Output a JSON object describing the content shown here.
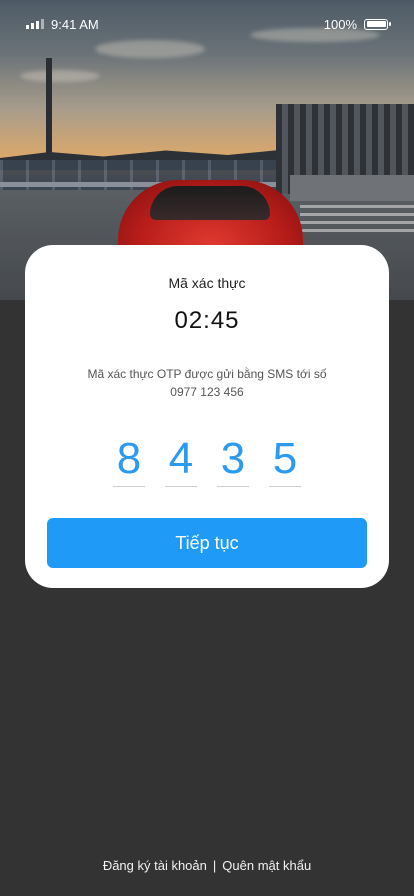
{
  "status_bar": {
    "time": "9:41 AM",
    "battery_percent": "100%",
    "signal_icon": "signal-bars-icon",
    "battery_icon": "battery-full-icon"
  },
  "otp_card": {
    "title": "Mã xác thực",
    "timer": "02:45",
    "description_line1": "Mã xác thực OTP được gửi bằng SMS tới số",
    "phone_number": "0977 123 456",
    "digits": [
      "8",
      "4",
      "3",
      "5"
    ],
    "continue_label": "Tiếp tục"
  },
  "footer": {
    "register_label": "Đăng ký tài khoản",
    "separator": "|",
    "forgot_password_label": "Quên mật khẩu"
  },
  "colors": {
    "accent": "#1f9bf7",
    "digit": "#2b9af3",
    "background": "#333333",
    "card": "#ffffff"
  }
}
